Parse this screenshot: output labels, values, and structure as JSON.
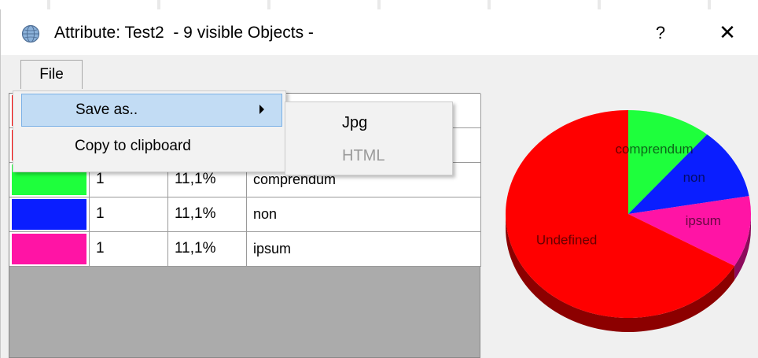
{
  "window": {
    "title": "Attribute: Test2  - 9 visible Objects -",
    "help_label": "?",
    "close_label": "✕",
    "icon": "app-globe-icon"
  },
  "menubar": {
    "file_label": "File"
  },
  "file_menu": {
    "items": [
      {
        "label": "Save as..",
        "has_submenu": true,
        "highlighted": true
      },
      {
        "label": "Copy to clipboard",
        "has_submenu": false,
        "highlighted": false
      }
    ]
  },
  "save_as_submenu": {
    "items": [
      {
        "label": "Jpg",
        "enabled": true
      },
      {
        "label": "HTML",
        "enabled": false
      }
    ]
  },
  "table": {
    "rows": [
      {
        "color": "#ff0000",
        "count": "",
        "percent": "",
        "name": ""
      },
      {
        "color": "#ff0000",
        "count": "",
        "percent": "",
        "name": ""
      },
      {
        "color": "#1eff3c",
        "count": "1",
        "percent": "11,1%",
        "name": "comprendum"
      },
      {
        "color": "#0a1eff",
        "count": "1",
        "percent": "11,1%",
        "name": "non"
      },
      {
        "color": "#ff14a5",
        "count": "1",
        "percent": "11,1%",
        "name": "ipsum"
      }
    ]
  },
  "chart_data": {
    "type": "pie",
    "title": "",
    "slices": [
      {
        "label": "Undefined",
        "value": 6,
        "color": "#ff0000"
      },
      {
        "label": "comprendum",
        "value": 1,
        "color": "#1eff3c"
      },
      {
        "label": "non",
        "value": 1,
        "color": "#0a1eff"
      },
      {
        "label": "ipsum",
        "value": 1,
        "color": "#ff14a5"
      }
    ]
  }
}
